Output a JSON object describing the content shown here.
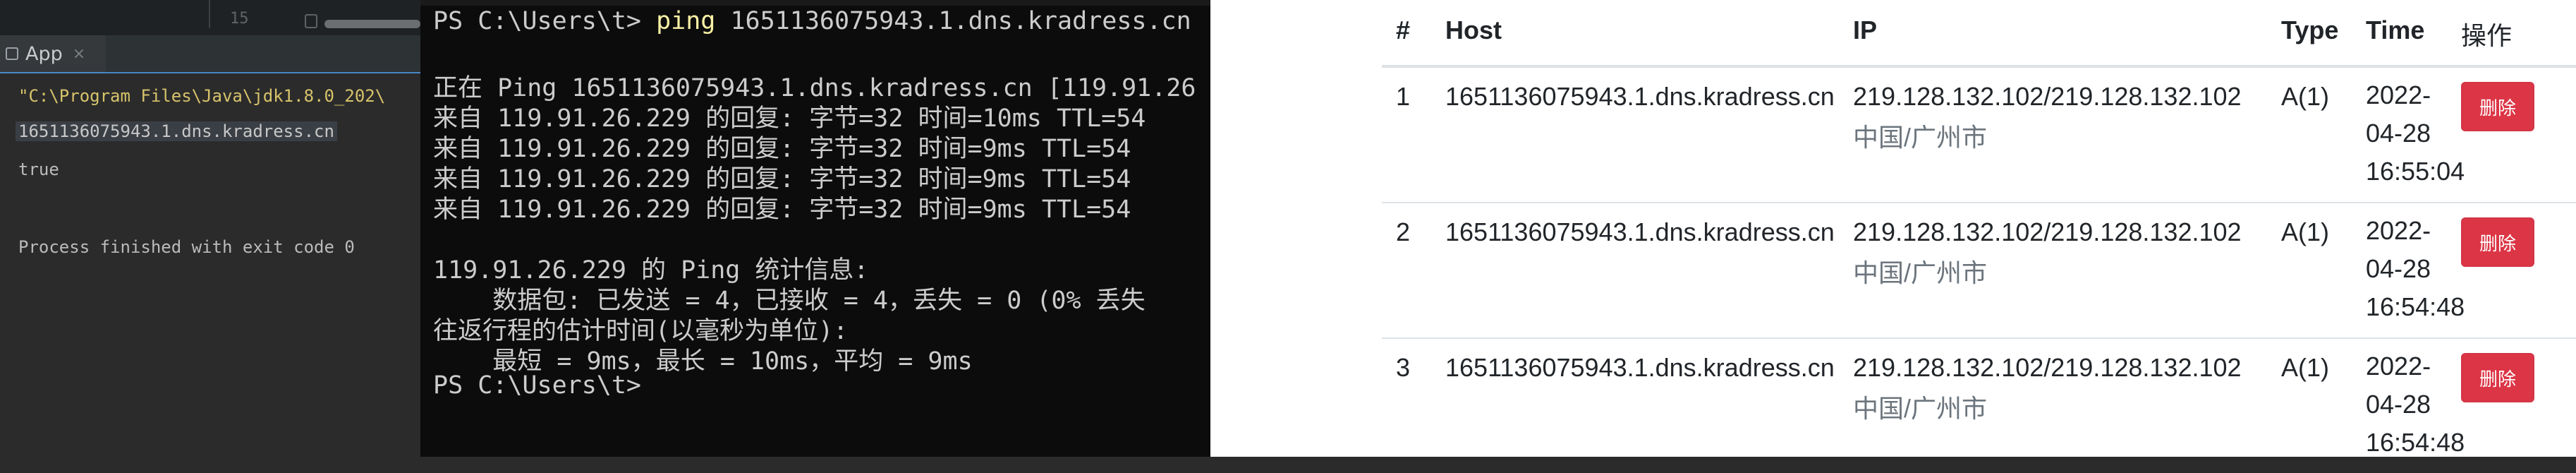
{
  "ide": {
    "line_number": "15",
    "tab_label": "App",
    "tab_close": "×",
    "console": {
      "command": "\"C:\\Program Files\\Java\\jdk1.8.0_202\\",
      "output1": "1651136075943.1.dns.kradress.cn",
      "output2": "true",
      "output3": "Process finished with exit code 0"
    }
  },
  "terminal": {
    "prompt1": "PS C:\\Users\\t>",
    "command_keyword": "ping",
    "command_arg": "1651136075943.1.dns.kradress.cn",
    "pinging": "正在 Ping 1651136075943.1.dns.kradress.cn [119.91.26",
    "replies": [
      "来自 119.91.26.229 的回复: 字节=32 时间=10ms TTL=54",
      "来自 119.91.26.229 的回复: 字节=32 时间=9ms TTL=54",
      "来自 119.91.26.229 的回复: 字节=32 时间=9ms TTL=54",
      "来自 119.91.26.229 的回复: 字节=32 时间=9ms TTL=54"
    ],
    "stats_header": "119.91.26.229 的 Ping 统计信息:",
    "stats_packets": "    数据包: 已发送 = 4，已接收 = 4，丢失 = 0 (0% 丢失",
    "rtt_header": "往返行程的估计时间(以毫秒为单位):",
    "rtt_values": "    最短 = 9ms，最长 = 10ms，平均 = 9ms",
    "prompt2": "PS C:\\Users\\t>"
  },
  "dns_table": {
    "headers": [
      "#",
      "Host",
      "IP",
      "Type",
      "Time",
      "操作"
    ],
    "rows": [
      {
        "num": "1",
        "host": "1651136075943.1.dns.kradress.cn",
        "ip": "219.128.132.102/219.128.132.102",
        "loc": "中国/广州市",
        "type": "A(1)",
        "time": [
          "2022-",
          "04-28",
          "16:55:04"
        ],
        "action": "删除"
      },
      {
        "num": "2",
        "host": "1651136075943.1.dns.kradress.cn",
        "ip": "219.128.132.102/219.128.132.102",
        "loc": "中国/广州市",
        "type": "A(1)",
        "time": [
          "2022-",
          "04-28",
          "16:54:48"
        ],
        "action": "删除"
      },
      {
        "num": "3",
        "host": "1651136075943.1.dns.kradress.cn",
        "ip": "219.128.132.102/219.128.132.102",
        "loc": "中国/广州市",
        "type": "A(1)",
        "time": [
          "2022-",
          "04-28",
          "16:54:48"
        ],
        "action": "删除"
      }
    ]
  },
  "colors": {
    "delete_button": "#dc3545",
    "prompt_keyword": "#f9f1a5",
    "console_command": "#d7c36b"
  }
}
